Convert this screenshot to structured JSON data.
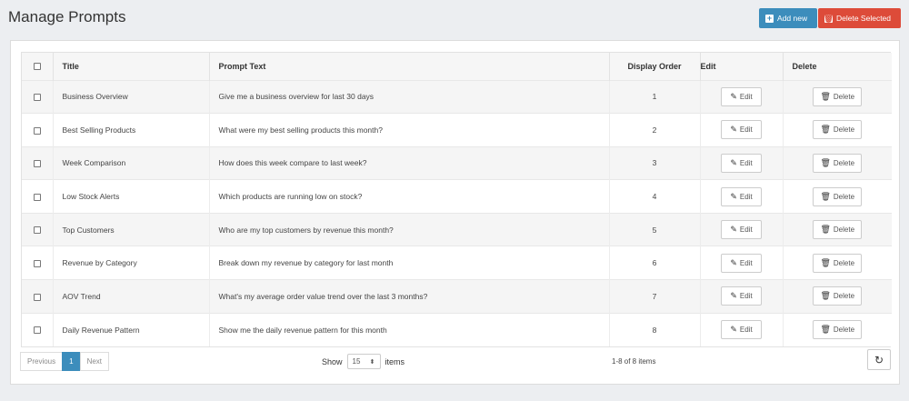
{
  "page": {
    "title": "Manage Prompts"
  },
  "actions": {
    "add_label": "Add new",
    "delete_selected_label": "Delete Selected"
  },
  "table": {
    "columns": [
      "Title",
      "Prompt Text",
      "Display Order",
      "Edit",
      "Delete"
    ],
    "edit_label": "Edit",
    "delete_label": "Delete",
    "rows": [
      {
        "title": "Business Overview",
        "prompt": "Give me a business overview for last 30 days",
        "order": "1"
      },
      {
        "title": "Best Selling Products",
        "prompt": "What were my best selling products this month?",
        "order": "2"
      },
      {
        "title": "Week Comparison",
        "prompt": "How does this week compare to last week?",
        "order": "3"
      },
      {
        "title": "Low Stock Alerts",
        "prompt": "Which products are running low on stock?",
        "order": "4"
      },
      {
        "title": "Top Customers",
        "prompt": "Who are my top customers by revenue this month?",
        "order": "5"
      },
      {
        "title": "Revenue by Category",
        "prompt": "Break down my revenue by category for last month",
        "order": "6"
      },
      {
        "title": "AOV Trend",
        "prompt": "What's my average order value trend over the last 3 months?",
        "order": "7"
      },
      {
        "title": "Daily Revenue Pattern",
        "prompt": "Show me the daily revenue pattern for this month",
        "order": "8"
      }
    ]
  },
  "pager": {
    "previous": "Previous",
    "current_page": "1",
    "next": "Next",
    "show_label": "Show",
    "page_size": "15",
    "items_label": "items",
    "count_text": "1-8 of 8 items"
  },
  "colors": {
    "primary": "#3c8dbc",
    "danger": "#dd4b39"
  }
}
